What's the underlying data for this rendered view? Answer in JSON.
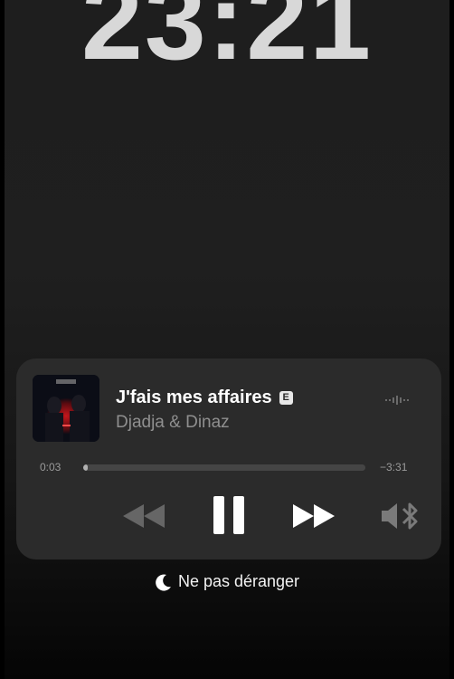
{
  "lockscreen": {
    "time": "23:21"
  },
  "now_playing": {
    "title": "J'fais mes affaires",
    "explicit_badge": "E",
    "artist": "Djadja & Dinaz",
    "elapsed": "0:03",
    "remaining": "−3:31",
    "progress_fraction": 0.014,
    "album_art_icon": "album-cover",
    "audio_route_icon": "speaker-bluetooth-icon",
    "waveform_icon": "waveform-icon"
  },
  "focus_mode": {
    "label": "Ne pas déranger",
    "icon": "moon-icon"
  },
  "colors": {
    "background": "#1e1e1e",
    "card": "#2b2b2b",
    "clock": "#d8d8d8",
    "secondary_text": "#8f8f8f",
    "inactive_control": "#666666"
  }
}
